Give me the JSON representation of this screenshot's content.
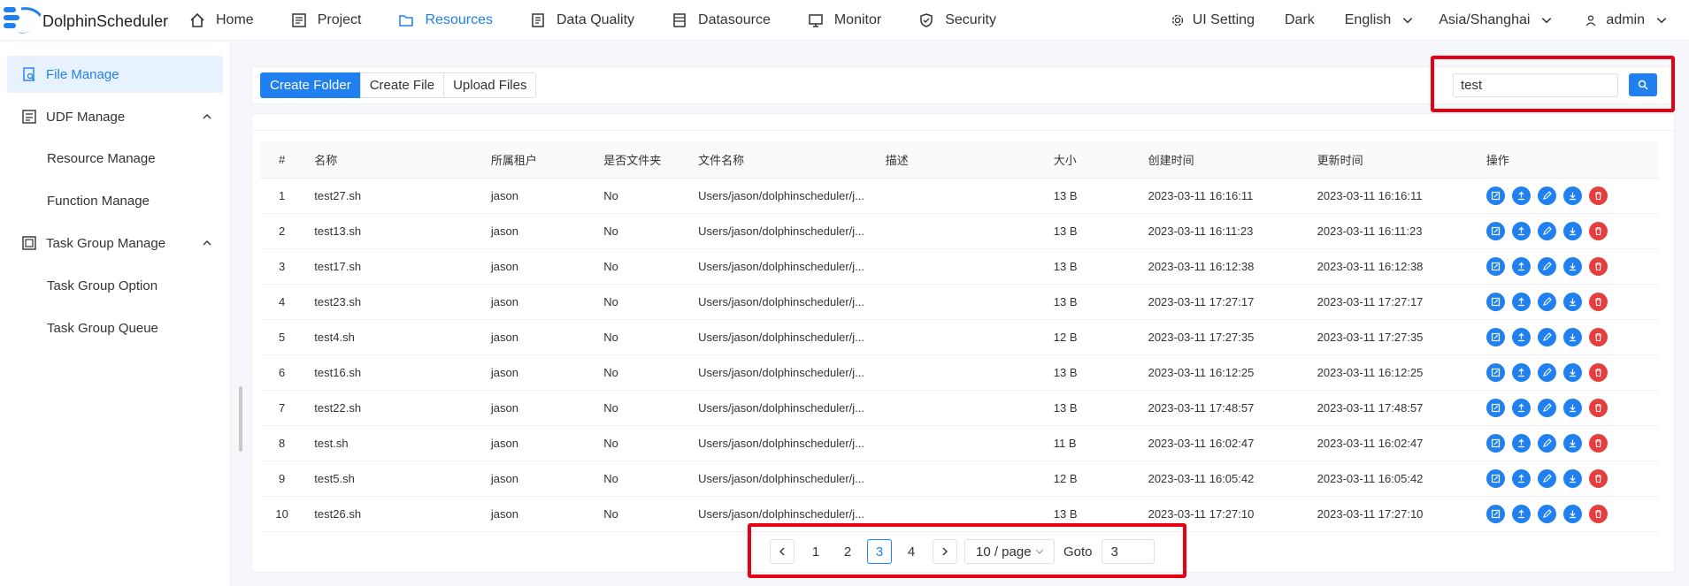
{
  "header": {
    "brand": "DolphinScheduler",
    "nav": [
      {
        "label": "Home",
        "icon": "home-icon"
      },
      {
        "label": "Project",
        "icon": "project-icon"
      },
      {
        "label": "Resources",
        "icon": "folder-icon",
        "active": true
      },
      {
        "label": "Data Quality",
        "icon": "data-quality-icon"
      },
      {
        "label": "Datasource",
        "icon": "datasource-icon"
      },
      {
        "label": "Monitor",
        "icon": "monitor-icon"
      },
      {
        "label": "Security",
        "icon": "shield-icon"
      }
    ],
    "ui_setting": "UI Setting",
    "theme": "Dark",
    "language": "English",
    "timezone": "Asia/Shanghai",
    "user": "admin"
  },
  "sidebar": {
    "items": [
      {
        "label": "File Manage",
        "icon": "file-search-icon",
        "active": true
      },
      {
        "label": "UDF Manage",
        "icon": "udf-icon"
      },
      {
        "label": "Resource Manage"
      },
      {
        "label": "Function Manage"
      },
      {
        "label": "Task Group Manage",
        "icon": "task-group-icon"
      },
      {
        "label": "Task Group Option"
      },
      {
        "label": "Task Group Queue"
      }
    ]
  },
  "toolbar": {
    "create_folder": "Create Folder",
    "create_file": "Create File",
    "upload_files": "Upload Files",
    "search_value": "test"
  },
  "table": {
    "headers": [
      "#",
      "名称",
      "所属租户",
      "是否文件夹",
      "文件名称",
      "描述",
      "大小",
      "创建时间",
      "更新时间",
      "操作"
    ],
    "rows": [
      {
        "idx": "1",
        "name": "test27.sh",
        "tenant": "jason",
        "dir": "No",
        "file": "Users/jason/dolphinscheduler/j...",
        "desc": "",
        "size": "13 B",
        "created": "2023-03-11 16:16:11",
        "updated": "2023-03-11 16:16:11"
      },
      {
        "idx": "2",
        "name": "test13.sh",
        "tenant": "jason",
        "dir": "No",
        "file": "Users/jason/dolphinscheduler/j...",
        "desc": "",
        "size": "13 B",
        "created": "2023-03-11 16:11:23",
        "updated": "2023-03-11 16:11:23"
      },
      {
        "idx": "3",
        "name": "test17.sh",
        "tenant": "jason",
        "dir": "No",
        "file": "Users/jason/dolphinscheduler/j...",
        "desc": "",
        "size": "13 B",
        "created": "2023-03-11 16:12:38",
        "updated": "2023-03-11 16:12:38"
      },
      {
        "idx": "4",
        "name": "test23.sh",
        "tenant": "jason",
        "dir": "No",
        "file": "Users/jason/dolphinscheduler/j...",
        "desc": "",
        "size": "13 B",
        "created": "2023-03-11 17:27:17",
        "updated": "2023-03-11 17:27:17"
      },
      {
        "idx": "5",
        "name": "test4.sh",
        "tenant": "jason",
        "dir": "No",
        "file": "Users/jason/dolphinscheduler/j...",
        "desc": "",
        "size": "12 B",
        "created": "2023-03-11 17:27:35",
        "updated": "2023-03-11 17:27:35"
      },
      {
        "idx": "6",
        "name": "test16.sh",
        "tenant": "jason",
        "dir": "No",
        "file": "Users/jason/dolphinscheduler/j...",
        "desc": "",
        "size": "13 B",
        "created": "2023-03-11 16:12:25",
        "updated": "2023-03-11 16:12:25"
      },
      {
        "idx": "7",
        "name": "test22.sh",
        "tenant": "jason",
        "dir": "No",
        "file": "Users/jason/dolphinscheduler/j...",
        "desc": "",
        "size": "13 B",
        "created": "2023-03-11 17:48:57",
        "updated": "2023-03-11 17:48:57"
      },
      {
        "idx": "8",
        "name": "test.sh",
        "tenant": "jason",
        "dir": "No",
        "file": "Users/jason/dolphinscheduler/j...",
        "desc": "",
        "size": "11 B",
        "created": "2023-03-11 16:02:47",
        "updated": "2023-03-11 16:02:47"
      },
      {
        "idx": "9",
        "name": "test5.sh",
        "tenant": "jason",
        "dir": "No",
        "file": "Users/jason/dolphinscheduler/j...",
        "desc": "",
        "size": "12 B",
        "created": "2023-03-11 16:05:42",
        "updated": "2023-03-11 16:05:42"
      },
      {
        "idx": "10",
        "name": "test26.sh",
        "tenant": "jason",
        "dir": "No",
        "file": "Users/jason/dolphinscheduler/j...",
        "desc": "",
        "size": "13 B",
        "created": "2023-03-11 17:27:10",
        "updated": "2023-03-11 17:27:10"
      }
    ],
    "row_actions": [
      "edit-icon",
      "rename-icon",
      "edit-pen-icon",
      "download-icon",
      "delete-icon"
    ]
  },
  "pagination": {
    "pages": [
      "1",
      "2",
      "3",
      "4"
    ],
    "current": "3",
    "page_size": "10 / page",
    "goto_label": "Goto",
    "goto_value": "3"
  },
  "colors": {
    "accent": "#2080f0",
    "danger": "#e53e3e",
    "highlight": "#e60012"
  }
}
